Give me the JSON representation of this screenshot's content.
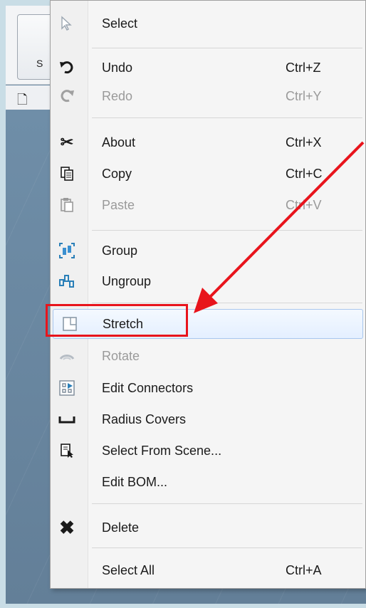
{
  "background": {
    "select_tool_label": "S",
    "new_doc_icon": "new-document-icon"
  },
  "menu": {
    "items": [
      {
        "label": "Select",
        "shortcut": "",
        "icon": "cursor-arrow-icon",
        "disabled": false
      },
      {
        "label": "Undo",
        "shortcut": "Ctrl+Z",
        "icon": "undo-icon",
        "disabled": false
      },
      {
        "label": "Redo",
        "shortcut": "Ctrl+Y",
        "icon": "redo-icon",
        "disabled": true
      },
      {
        "label": "About",
        "shortcut": "Ctrl+X",
        "icon": "scissors-icon",
        "disabled": false
      },
      {
        "label": "Copy",
        "shortcut": "Ctrl+C",
        "icon": "copy-icon",
        "disabled": false
      },
      {
        "label": "Paste",
        "shortcut": "Ctrl+V",
        "icon": "paste-icon",
        "disabled": true
      },
      {
        "label": "Group",
        "shortcut": "",
        "icon": "group-icon",
        "disabled": false
      },
      {
        "label": "Ungroup",
        "shortcut": "",
        "icon": "ungroup-icon",
        "disabled": false
      },
      {
        "label": "Stretch",
        "shortcut": "",
        "icon": "stretch-icon",
        "disabled": false,
        "highlighted": true
      },
      {
        "label": "Rotate",
        "shortcut": "",
        "icon": "rotate-icon",
        "disabled": true
      },
      {
        "label": "Edit Connectors",
        "shortcut": "",
        "icon": "edit-connectors-icon",
        "disabled": false
      },
      {
        "label": "Radius Covers",
        "shortcut": "",
        "icon": "radius-covers-icon",
        "disabled": false
      },
      {
        "label": "Select From Scene...",
        "shortcut": "",
        "icon": "select-from-scene-icon",
        "disabled": false
      },
      {
        "label": "Edit BOM...",
        "shortcut": "",
        "icon": "",
        "disabled": false
      },
      {
        "label": "Delete",
        "shortcut": "",
        "icon": "delete-x-icon",
        "disabled": false
      },
      {
        "label": "Select All",
        "shortcut": "Ctrl+A",
        "icon": "",
        "disabled": false
      }
    ]
  },
  "colors": {
    "annotation": "#e8141c",
    "highlight_border": "#a9c7ee"
  }
}
